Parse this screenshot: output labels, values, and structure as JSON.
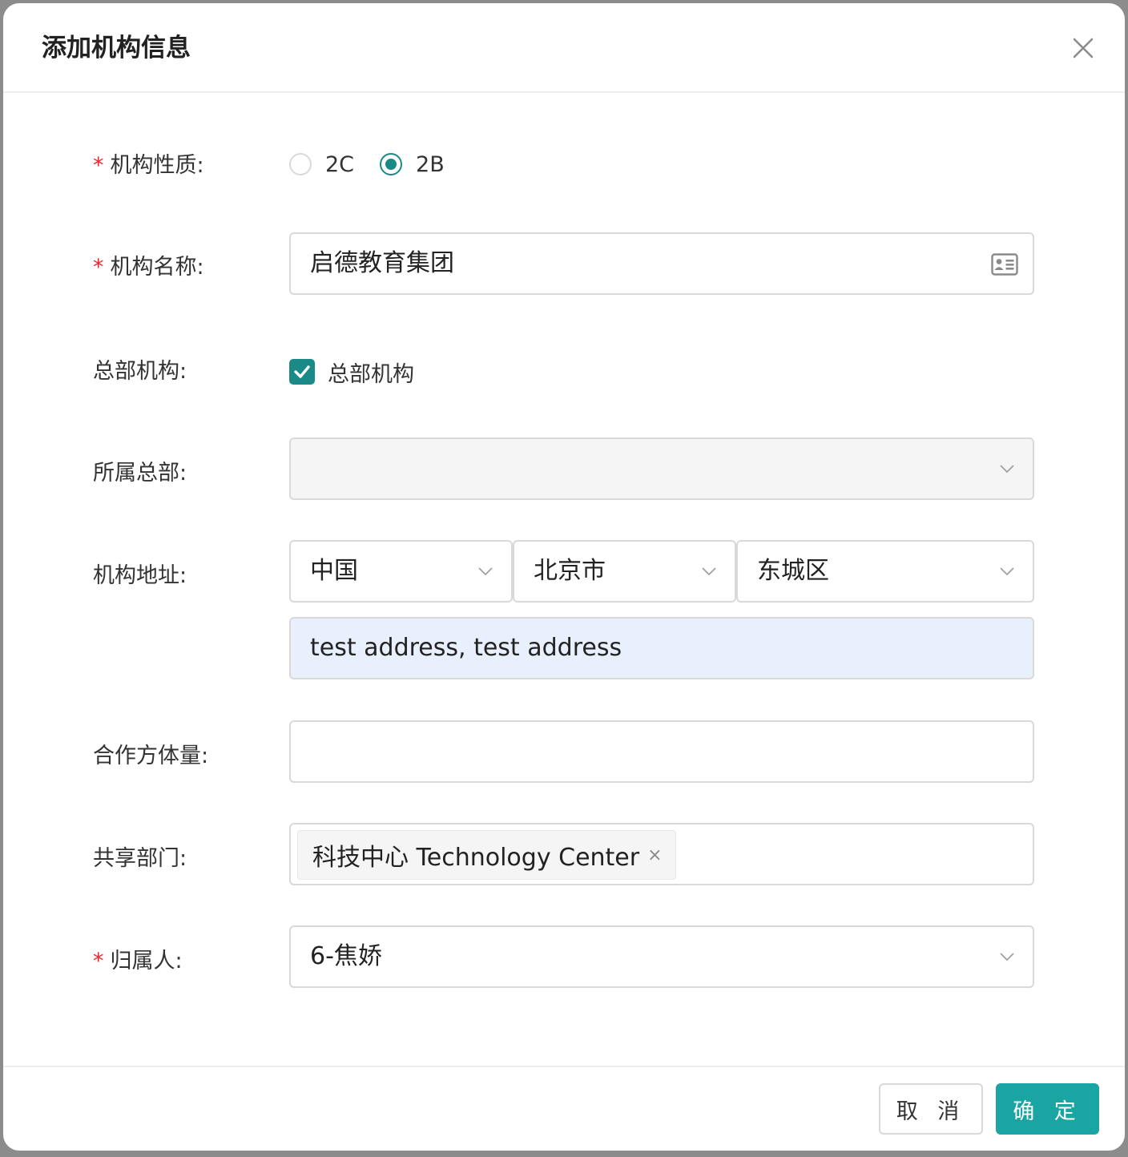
{
  "dialog": {
    "title": "添加机构信息",
    "close_icon": "close-icon"
  },
  "form": {
    "nature": {
      "required": "*",
      "label": "机构性质:",
      "options": [
        "2C",
        "2B"
      ],
      "selected": "2B"
    },
    "name": {
      "required": "*",
      "label": "机构名称:",
      "value": "启德教育集团",
      "icon": "contact-card-icon"
    },
    "headquarters": {
      "label": "总部机构:",
      "checkbox_label": "总部机构",
      "checked": true
    },
    "parent_hq": {
      "label": "所属总部:",
      "value": "",
      "disabled": true
    },
    "address": {
      "label": "机构地址:",
      "country": "中国",
      "city": "北京市",
      "district": "东城区",
      "detail": "test address, test address"
    },
    "partner_size": {
      "label": "合作方体量:",
      "value": ""
    },
    "shared_dept": {
      "label": "共享部门:",
      "tags": [
        "科技中心 Technology Center"
      ],
      "tag_close": "×"
    },
    "owner": {
      "required": "*",
      "label": "归属人:",
      "value": "6-焦娇"
    }
  },
  "footer": {
    "cancel_label": "取 消",
    "ok_label": "确 定"
  },
  "colors": {
    "accent": "#1a8a88",
    "primary_button": "#1aa5a3",
    "required": "#f5222d",
    "autofill": "#e8f0fe",
    "disabled": "#f5f5f5"
  }
}
